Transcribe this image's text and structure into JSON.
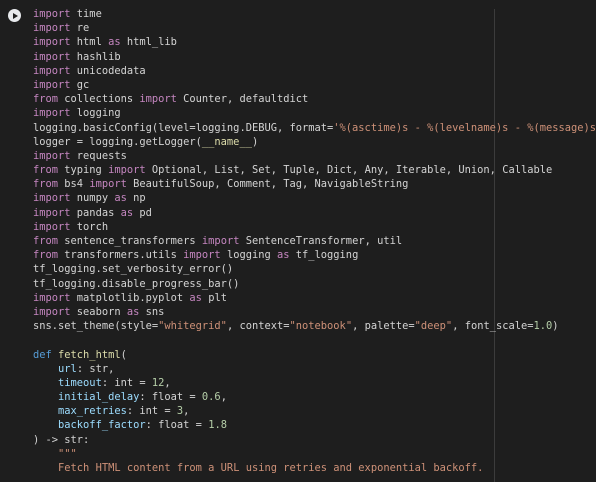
{
  "cell": {
    "run_label": "Run cell",
    "lines": [
      [
        [
          "kw",
          "import"
        ],
        [
          "",
          "time"
        ]
      ],
      [
        [
          "kw",
          "import"
        ],
        [
          "",
          "re"
        ]
      ],
      [
        [
          "kw",
          "import"
        ],
        [
          "",
          "html"
        ],
        [
          "kw",
          "as"
        ],
        [
          "",
          "html_lib"
        ]
      ],
      [
        [
          "kw",
          "import"
        ],
        [
          "",
          "hashlib"
        ]
      ],
      [
        [
          "kw",
          "import"
        ],
        [
          "",
          "unicodedata"
        ]
      ],
      [
        [
          "kw",
          "import"
        ],
        [
          "",
          "gc"
        ]
      ],
      [
        [
          "kw",
          "from"
        ],
        [
          "",
          "collections"
        ],
        [
          "kw",
          "import"
        ],
        [
          "",
          "Counter, defaultdict"
        ]
      ],
      [
        [
          "kw",
          "import"
        ],
        [
          "",
          "logging"
        ]
      ],
      [
        [
          "",
          "logging.basicConfig(level=logging.DEBUG, format="
        ],
        [
          "st",
          "'%(asctime)s - %(levelname)s - %(message)s'"
        ],
        [
          "",
          ")"
        ]
      ],
      [
        [
          "",
          "logger = logging.getLogger("
        ],
        [
          "fn",
          "__name__"
        ],
        [
          "",
          ")"
        ]
      ],
      [
        [
          "kw",
          "import"
        ],
        [
          "",
          "requests"
        ]
      ],
      [
        [
          "kw",
          "from"
        ],
        [
          "",
          "typing"
        ],
        [
          "kw",
          "import"
        ],
        [
          "",
          "Optional, List, Set, Tuple, Dict, Any, Iterable, Union, Callable"
        ]
      ],
      [
        [
          "kw",
          "from"
        ],
        [
          "",
          "bs4"
        ],
        [
          "kw",
          "import"
        ],
        [
          "",
          "BeautifulSoup, Comment, Tag, NavigableString"
        ]
      ],
      [
        [
          "kw",
          "import"
        ],
        [
          "",
          "numpy"
        ],
        [
          "kw",
          "as"
        ],
        [
          "",
          "np"
        ]
      ],
      [
        [
          "kw",
          "import"
        ],
        [
          "",
          "pandas"
        ],
        [
          "kw",
          "as"
        ],
        [
          "",
          "pd"
        ]
      ],
      [
        [
          "kw",
          "import"
        ],
        [
          "",
          "torch"
        ]
      ],
      [
        [
          "kw",
          "from"
        ],
        [
          "",
          "sentence_transformers"
        ],
        [
          "kw",
          "import"
        ],
        [
          "",
          "SentenceTransformer, util"
        ]
      ],
      [
        [
          "kw",
          "from"
        ],
        [
          "",
          "transformers.utils"
        ],
        [
          "kw",
          "import"
        ],
        [
          "",
          "logging"
        ],
        [
          "kw",
          "as"
        ],
        [
          "",
          "tf_logging"
        ]
      ],
      [
        [
          "",
          "tf_logging.set_verbosity_error()"
        ]
      ],
      [
        [
          "",
          "tf_logging.disable_progress_bar()"
        ]
      ],
      [
        [
          "kw",
          "import"
        ],
        [
          "",
          "matplotlib.pyplot"
        ],
        [
          "kw",
          "as"
        ],
        [
          "",
          "plt"
        ]
      ],
      [
        [
          "kw",
          "import"
        ],
        [
          "",
          "seaborn"
        ],
        [
          "kw",
          "as"
        ],
        [
          "",
          "sns"
        ]
      ],
      [
        [
          "",
          "sns.set_theme(style="
        ],
        [
          "st",
          "\"whitegrid\""
        ],
        [
          "",
          ", context="
        ],
        [
          "st",
          "\"notebook\""
        ],
        [
          "",
          ", palette="
        ],
        [
          "st",
          "\"deep\""
        ],
        [
          "",
          ", font_scale="
        ],
        [
          "nm",
          "1.0"
        ],
        [
          "",
          ")"
        ]
      ],
      [
        [
          "",
          ""
        ]
      ],
      [
        [
          "df",
          "def"
        ],
        [
          "fn",
          "fetch_html"
        ],
        [
          "",
          "("
        ]
      ],
      [
        [
          "",
          "    "
        ],
        [
          "pm",
          "url"
        ],
        [
          "",
          ": str,"
        ]
      ],
      [
        [
          "",
          "    "
        ],
        [
          "pm",
          "timeout"
        ],
        [
          "",
          ": int = "
        ],
        [
          "nm",
          "12"
        ],
        [
          "",
          ","
        ]
      ],
      [
        [
          "",
          "    "
        ],
        [
          "pm",
          "initial_delay"
        ],
        [
          "",
          ": float = "
        ],
        [
          "nm",
          "0.6"
        ],
        [
          "",
          ","
        ]
      ],
      [
        [
          "",
          "    "
        ],
        [
          "pm",
          "max_retries"
        ],
        [
          "",
          ": int = "
        ],
        [
          "nm",
          "3"
        ],
        [
          "",
          ","
        ]
      ],
      [
        [
          "",
          "    "
        ],
        [
          "pm",
          "backoff_factor"
        ],
        [
          "",
          ": float = "
        ],
        [
          "nm",
          "1.8"
        ]
      ],
      [
        [
          "",
          ") -> str:"
        ]
      ],
      [
        [
          "",
          "    "
        ],
        [
          "st",
          "\"\"\""
        ]
      ],
      [
        [
          "",
          "    "
        ],
        [
          "st",
          "Fetch HTML content from a URL using retries and exponential backoff."
        ]
      ]
    ]
  }
}
